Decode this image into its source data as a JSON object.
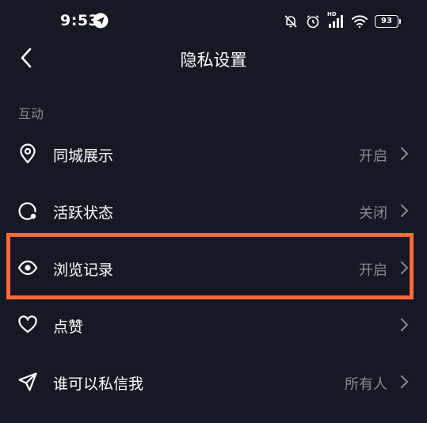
{
  "status_bar": {
    "time": "9:53",
    "battery_level": "93",
    "network_label": "HD"
  },
  "header": {
    "title": "隐私设置"
  },
  "section": {
    "title": "互动"
  },
  "items": [
    {
      "label": "同城展示",
      "value": "开启",
      "icon": "location-pin-icon"
    },
    {
      "label": "活跃状态",
      "value": "关闭",
      "icon": "activity-status-icon"
    },
    {
      "label": "浏览记录",
      "value": "开启",
      "icon": "eye-icon"
    },
    {
      "label": "点赞",
      "value": "",
      "icon": "heart-icon"
    },
    {
      "label": "谁可以私信我",
      "value": "所有人",
      "icon": "send-icon"
    }
  ],
  "colors": {
    "background": "#161823",
    "primary_text": "#ffffff",
    "secondary_text": "#8a8b91",
    "highlight_border": "#ff6a3a"
  }
}
